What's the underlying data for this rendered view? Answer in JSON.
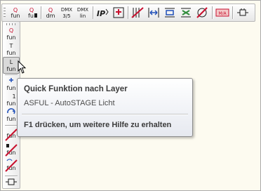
{
  "toolbar": {
    "buttons": [
      {
        "name": "fun-quick-button",
        "icon": "fun-q-icon",
        "text": "fun"
      },
      {
        "name": "fun-q2-button",
        "icon": "fun-q2-icon",
        "text": "fu"
      },
      {
        "name": "dmx-q-button",
        "icon": "dm-q-icon",
        "text": "dm"
      },
      {
        "name": "dmx-35-button",
        "icon": "dmx-icon",
        "text": "DMX",
        "sub": "3/5"
      },
      {
        "name": "dmx-lin-button",
        "icon": "dmx-lin-icon",
        "text": "DMX",
        "sub": "lin"
      },
      {
        "name": "ip-button",
        "icon": "ip-icon",
        "text": "IP"
      },
      {
        "name": "plus-button",
        "icon": "add-icon"
      },
      {
        "name": "strike-button",
        "icon": "strike-icon"
      },
      {
        "name": "distribute-button",
        "icon": "distribute-icon"
      },
      {
        "name": "align-button",
        "icon": "align-icon"
      },
      {
        "name": "swap-button",
        "icon": "swap-icon"
      },
      {
        "name": "cancel-button",
        "icon": "cancel-icon"
      },
      {
        "name": "ma-button",
        "icon": "ma-icon",
        "text": "M/A"
      },
      {
        "name": "plug-button",
        "icon": "plug-icon"
      }
    ]
  },
  "sidebar": {
    "items": [
      {
        "name": "fun-q",
        "label": "fun",
        "top": "Q"
      },
      {
        "name": "fun-t",
        "label": "fun",
        "top": "T"
      },
      {
        "name": "fun-l",
        "label": "fun",
        "top": "L"
      },
      {
        "name": "fun-plus",
        "label": "fun"
      },
      {
        "name": "fun-1",
        "label": "fun",
        "top": "1"
      },
      {
        "name": "fun-rotate",
        "label": "fun"
      },
      {
        "name": "fun-strike1",
        "label": "fun"
      },
      {
        "name": "fun-strike2",
        "label": "fun"
      },
      {
        "name": "fun-strike3",
        "label": "fun"
      }
    ]
  },
  "tooltip": {
    "title": "Quick Funktion nach Layer",
    "description": "ASFUL - AutoSTAGE Licht",
    "help": "F1 drücken, um weitere Hilfe zu erhalten"
  },
  "colors": {
    "accent_red": "#c8102e",
    "icon_dark": "#1a1a1a",
    "icon_blue": "#1f4fb8"
  }
}
